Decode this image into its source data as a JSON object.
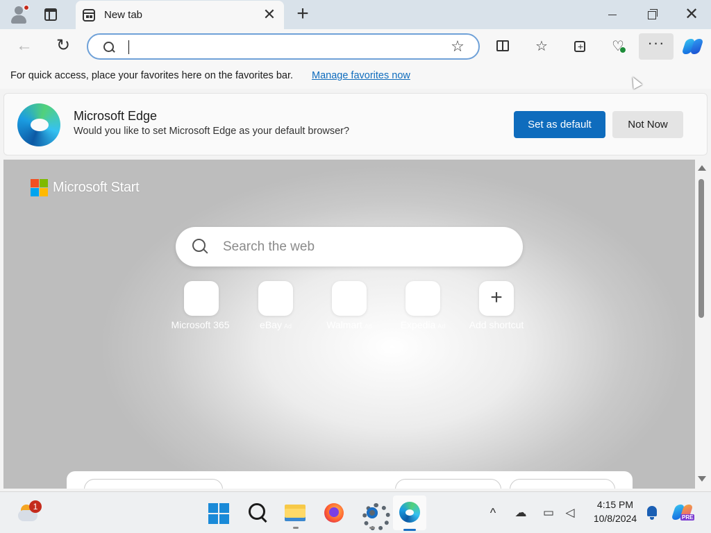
{
  "window": {
    "tab_title": "New tab",
    "close_tab_glyph": "✕",
    "new_tab_glyph": "+",
    "window_close_glyph": "✕"
  },
  "toolbar": {
    "back_glyph": "←",
    "refresh_glyph": "↻",
    "address_value": "",
    "address_placeholder": "",
    "favorite_star_glyph": "☆",
    "favorites_glyph": "☆",
    "health_glyph": "♡",
    "more_glyph": "···"
  },
  "favorites_bar": {
    "message": "For quick access, place your favorites here on the favorites bar.",
    "link": "Manage favorites now"
  },
  "banner": {
    "title": "Microsoft Edge",
    "subtitle": "Would you like to set Microsoft Edge as your default browser?",
    "primary_button": "Set as default",
    "secondary_button": "Not Now"
  },
  "new_tab": {
    "brand": "Microsoft Start",
    "search_placeholder": "Search the web",
    "shortcuts": [
      {
        "label": "Microsoft 365",
        "ad": ""
      },
      {
        "label": "eBay",
        "ad": "Ad"
      },
      {
        "label": "Walmart",
        "ad": "Ad"
      },
      {
        "label": "Expedia",
        "ad": "Ad"
      },
      {
        "label": "Add shortcut",
        "ad": ""
      }
    ]
  },
  "taskbar": {
    "weather_badge": "1",
    "clock_time": "4:15 PM",
    "clock_date": "10/8/2024",
    "tray_chevron": "^",
    "pre_badge": "PRE",
    "colors": {
      "accent": "#0f6cbd",
      "start_blue": "#1a8ad8"
    }
  },
  "icons": [
    "profile-icon",
    "tab-actions-icon",
    "new-tab-page-icon",
    "close-icon",
    "plus-icon",
    "minimize-icon",
    "restore-icon",
    "back-arrow-icon",
    "refresh-icon",
    "search-icon",
    "star-icon",
    "split-screen-icon",
    "favorites-icon",
    "collections-icon",
    "browser-essentials-icon",
    "more-icon",
    "copilot-icon",
    "edge-logo-icon",
    "microsoft-logo-icon",
    "weather-icon",
    "windows-start-icon",
    "file-explorer-icon",
    "firefox-icon",
    "settings-icon",
    "edge-icon",
    "onedrive-icon",
    "network-icon",
    "volume-icon",
    "bell-icon"
  ]
}
